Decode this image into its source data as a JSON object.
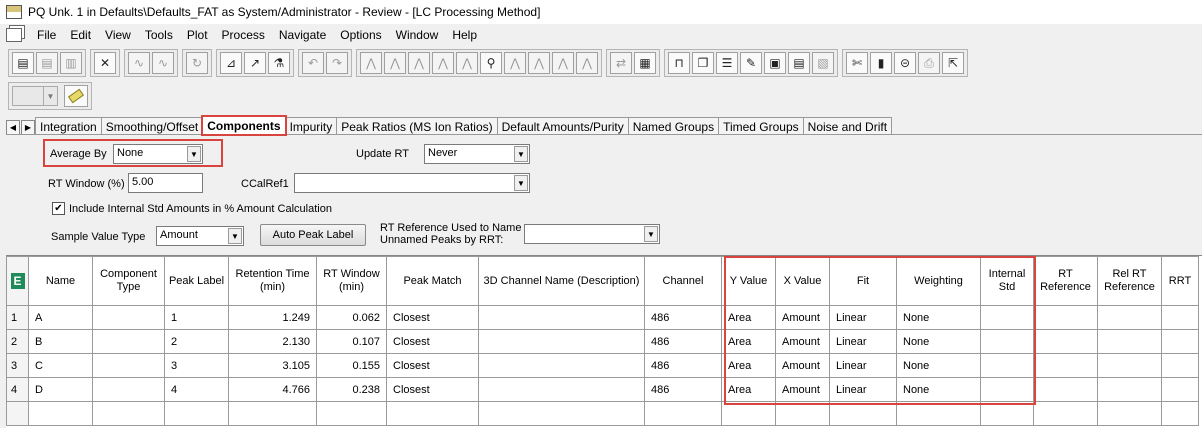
{
  "window": {
    "title": "PQ Unk. 1 in Defaults\\Defaults_FAT as System/Administrator - Review - [LC Processing Method]"
  },
  "menu": [
    "File",
    "Edit",
    "View",
    "Tools",
    "Plot",
    "Process",
    "Navigate",
    "Options",
    "Window",
    "Help"
  ],
  "toolbar": {
    "icons": [
      "open-method-icon",
      "save-method-icon",
      "print-icon",
      "tools-icon",
      "smooth-icon",
      "integrate-icon",
      "refresh-icon",
      "calibrate-icon",
      "quantitate-icon",
      "review-icon",
      "undo-icon",
      "redo-icon",
      "peak-icon",
      "peak2-icon",
      "peak3-icon",
      "peak4-icon",
      "peak5-icon",
      "peak6-icon",
      "peak7-icon",
      "peak8-icon",
      "peak9-icon",
      "peak10-icon",
      "compare-icon",
      "chart-icon",
      "view1-icon",
      "view2-icon",
      "view3-icon",
      "view4-icon",
      "view5-icon",
      "view6-icon",
      "view7-icon",
      "tools2-icon",
      "vial-icon",
      "disk-icon",
      "printer2-icon",
      "export-icon"
    ]
  },
  "tabs": [
    "Integration",
    "Smoothing/Offset",
    "Components",
    "Impurity",
    "Peak Ratios (MS Ion Ratios)",
    "Default Amounts/Purity",
    "Named Groups",
    "Timed Groups",
    "Noise and Drift"
  ],
  "active_tab": "Components",
  "form": {
    "average_by_label": "Average By",
    "average_by_value": "None",
    "update_rt_label": "Update RT",
    "update_rt_value": "Never",
    "rt_window_label": "RT Window (%)",
    "rt_window_value": "5.00",
    "ccalref_label": "CCalRef1",
    "ccalref_value": "",
    "include_internal_label": "Include Internal Std Amounts in % Amount Calculation",
    "include_internal_checked": true,
    "sample_value_type_label": "Sample Value Type",
    "sample_value_type_value": "Amount",
    "auto_peak_label_button": "Auto Peak Label",
    "rt_reference_label_line1": "RT Reference Used to Name",
    "rt_reference_label_line2": "Unnamed Peaks by RRT:",
    "rt_reference_value": ""
  },
  "grid": {
    "columns": [
      "Name",
      "Component Type",
      "Peak Label",
      "Retention Time (min)",
      "RT Window (min)",
      "Peak Match",
      "3D Channel Name (Description)",
      "Channel",
      "Y Value",
      "X Value",
      "Fit",
      "Weighting",
      "Internal Std",
      "RT Reference",
      "Rel RT Reference",
      "RRT"
    ],
    "rows": [
      {
        "num": "1",
        "cells": [
          "A",
          "",
          "1",
          "1.249",
          "0.062",
          "Closest",
          "",
          "486",
          "Area",
          "Amount",
          "Linear",
          "None",
          "",
          "",
          "",
          ""
        ]
      },
      {
        "num": "2",
        "cells": [
          "B",
          "",
          "2",
          "2.130",
          "0.107",
          "Closest",
          "",
          "486",
          "Area",
          "Amount",
          "Linear",
          "None",
          "",
          "",
          "",
          ""
        ]
      },
      {
        "num": "3",
        "cells": [
          "C",
          "",
          "3",
          "3.105",
          "0.155",
          "Closest",
          "",
          "486",
          "Area",
          "Amount",
          "Linear",
          "None",
          "",
          "",
          "",
          ""
        ]
      },
      {
        "num": "4",
        "cells": [
          "D",
          "",
          "4",
          "4.766",
          "0.238",
          "Closest",
          "",
          "486",
          "Area",
          "Amount",
          "Linear",
          "None",
          "",
          "",
          "",
          ""
        ]
      }
    ]
  },
  "colors": {
    "highlight": "#d9443f",
    "grid_icon": "#1f8a5a"
  }
}
